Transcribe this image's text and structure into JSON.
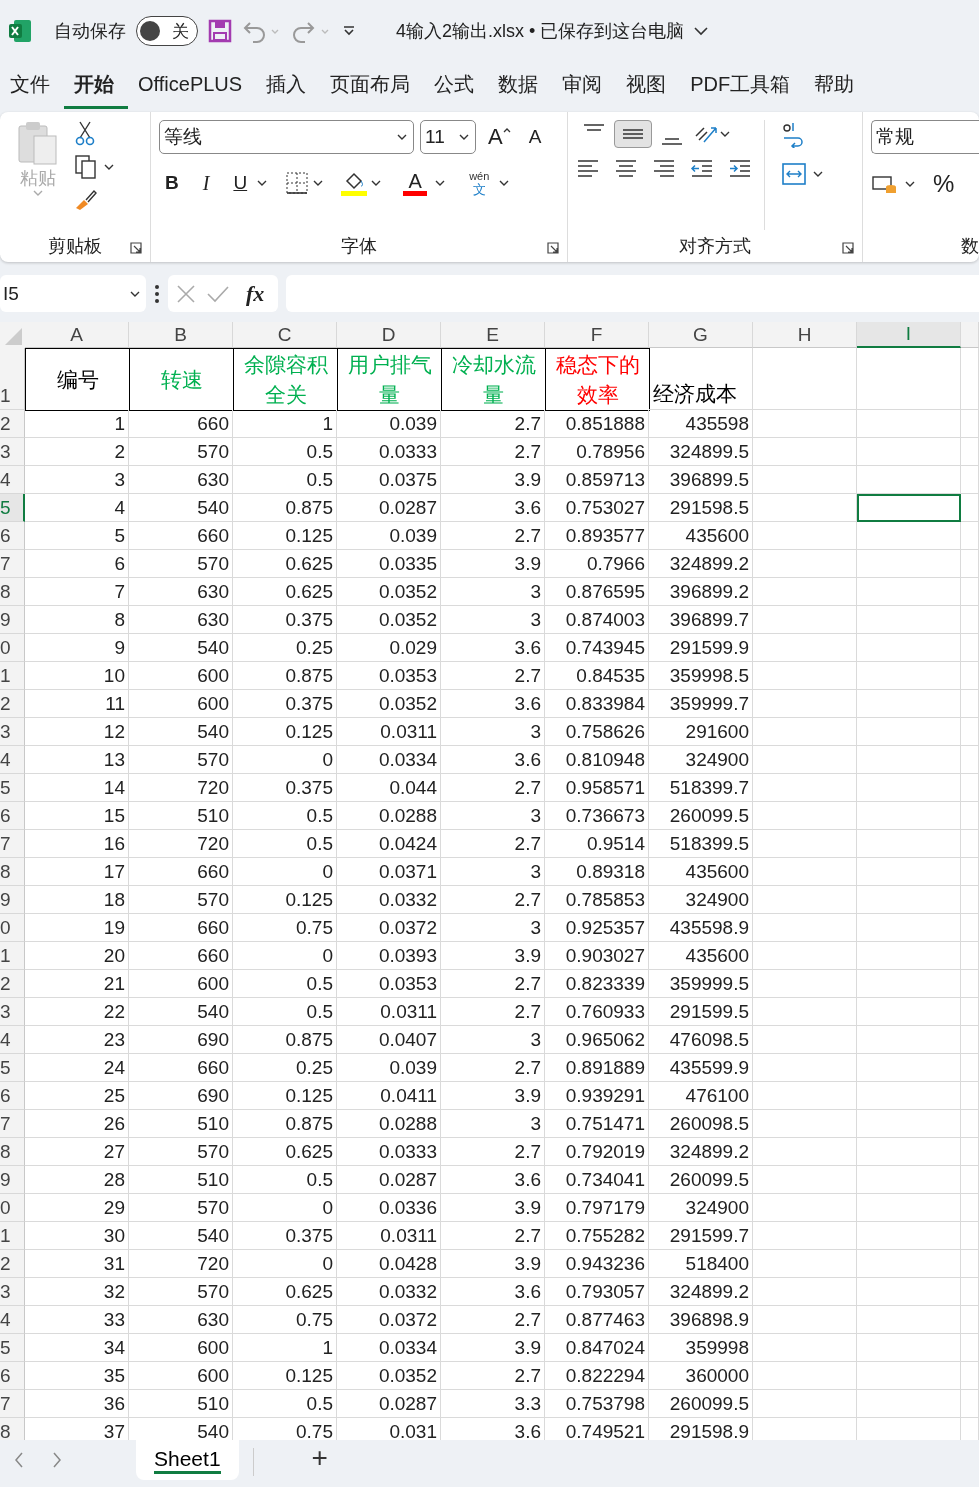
{
  "title_bar": {
    "autosave_label": "自动保存",
    "autosave_on": false,
    "autosave_state": "关",
    "title": "4输入2输出.xlsx • 已保存到这台电脑"
  },
  "tabs": [
    {
      "label": "文件",
      "selected": false
    },
    {
      "label": "开始",
      "selected": true
    },
    {
      "label": "OfficePLUS",
      "selected": false
    },
    {
      "label": "插入",
      "selected": false
    },
    {
      "label": "页面布局",
      "selected": false
    },
    {
      "label": "公式",
      "selected": false
    },
    {
      "label": "数据",
      "selected": false
    },
    {
      "label": "审阅",
      "selected": false
    },
    {
      "label": "视图",
      "selected": false
    },
    {
      "label": "PDF工具箱",
      "selected": false
    },
    {
      "label": "帮助",
      "selected": false
    }
  ],
  "ribbon": {
    "paste_label": "粘贴",
    "clipboard_label": "剪贴板",
    "font_name": "等线",
    "font_size": "11",
    "grow_font": "A",
    "shrink_font": "A",
    "bold": "B",
    "italic": "I",
    "underline": "U",
    "font_color": "A",
    "phonetic": "wén",
    "phonetic_char": "文",
    "font_label": "字体",
    "vertical_align": [
      {
        "selected": false
      },
      {
        "selected": true
      },
      {
        "selected": false
      }
    ],
    "alignment_label": "对齐方式",
    "number_format": "常规",
    "percent": "%",
    "number_label": "数"
  },
  "formula_bar": {
    "name_box": "I5",
    "fx": "fx"
  },
  "columns": [
    {
      "label": "A",
      "selected": false
    },
    {
      "label": "B",
      "selected": false
    },
    {
      "label": "C",
      "selected": false
    },
    {
      "label": "D",
      "selected": false
    },
    {
      "label": "E",
      "selected": false
    },
    {
      "label": "F",
      "selected": false
    },
    {
      "label": "G",
      "selected": false
    },
    {
      "label": "H",
      "selected": false
    },
    {
      "label": "I",
      "selected": true
    }
  ],
  "header_row": {
    "row_label": "1",
    "cells": [
      {
        "text": "编号",
        "color": "#000000",
        "bordered": true
      },
      {
        "text": "转速",
        "color": "#00b050",
        "bordered": true
      },
      {
        "text": "余隙容积全关",
        "color": "#00b050",
        "bordered": true
      },
      {
        "text": "用户排气量",
        "color": "#00b050",
        "bordered": true
      },
      {
        "text": "冷却水流量",
        "color": "#00b050",
        "bordered": true
      },
      {
        "text": "稳态下的效率",
        "color": "#ff0000",
        "bordered": true
      },
      {
        "text": "经济成本",
        "color": "#000000",
        "bordered": false
      }
    ]
  },
  "rows": [
    {
      "row_label": "2",
      "selected": false,
      "cells": [
        "1",
        "660",
        "1",
        "0.039",
        "2.7",
        "0.851888",
        "435598"
      ]
    },
    {
      "row_label": "3",
      "selected": false,
      "cells": [
        "2",
        "570",
        "0.5",
        "0.0333",
        "2.7",
        "0.78956",
        "324899.5"
      ]
    },
    {
      "row_label": "4",
      "selected": false,
      "cells": [
        "3",
        "630",
        "0.5",
        "0.0375",
        "3.9",
        "0.859713",
        "396899.5"
      ]
    },
    {
      "row_label": "5",
      "selected": true,
      "cells": [
        "4",
        "540",
        "0.875",
        "0.0287",
        "3.6",
        "0.753027",
        "291598.5"
      ]
    },
    {
      "row_label": "6",
      "selected": false,
      "cells": [
        "5",
        "660",
        "0.125",
        "0.039",
        "2.7",
        "0.893577",
        "435600"
      ]
    },
    {
      "row_label": "7",
      "selected": false,
      "cells": [
        "6",
        "570",
        "0.625",
        "0.0335",
        "3.9",
        "0.7966",
        "324899.2"
      ]
    },
    {
      "row_label": "8",
      "selected": false,
      "cells": [
        "7",
        "630",
        "0.625",
        "0.0352",
        "3",
        "0.876595",
        "396899.2"
      ]
    },
    {
      "row_label": "9",
      "selected": false,
      "cells": [
        "8",
        "630",
        "0.375",
        "0.0352",
        "3",
        "0.874003",
        "396899.7"
      ]
    },
    {
      "row_label": "0",
      "selected": false,
      "cells": [
        "9",
        "540",
        "0.25",
        "0.029",
        "3.6",
        "0.743945",
        "291599.9"
      ]
    },
    {
      "row_label": "1",
      "selected": false,
      "cells": [
        "10",
        "600",
        "0.875",
        "0.0353",
        "2.7",
        "0.84535",
        "359998.5"
      ]
    },
    {
      "row_label": "2",
      "selected": false,
      "cells": [
        "11",
        "600",
        "0.375",
        "0.0352",
        "3.6",
        "0.833984",
        "359999.7"
      ]
    },
    {
      "row_label": "3",
      "selected": false,
      "cells": [
        "12",
        "540",
        "0.125",
        "0.0311",
        "3",
        "0.758626",
        "291600"
      ]
    },
    {
      "row_label": "4",
      "selected": false,
      "cells": [
        "13",
        "570",
        "0",
        "0.0334",
        "3.6",
        "0.810948",
        "324900"
      ]
    },
    {
      "row_label": "5",
      "selected": false,
      "cells": [
        "14",
        "720",
        "0.375",
        "0.044",
        "2.7",
        "0.958571",
        "518399.7"
      ]
    },
    {
      "row_label": "6",
      "selected": false,
      "cells": [
        "15",
        "510",
        "0.5",
        "0.0288",
        "3",
        "0.736673",
        "260099.5"
      ]
    },
    {
      "row_label": "7",
      "selected": false,
      "cells": [
        "16",
        "720",
        "0.5",
        "0.0424",
        "2.7",
        "0.9514",
        "518399.5"
      ]
    },
    {
      "row_label": "8",
      "selected": false,
      "cells": [
        "17",
        "660",
        "0",
        "0.0371",
        "3",
        "0.89318",
        "435600"
      ]
    },
    {
      "row_label": "9",
      "selected": false,
      "cells": [
        "18",
        "570",
        "0.125",
        "0.0332",
        "2.7",
        "0.785853",
        "324900"
      ]
    },
    {
      "row_label": "0",
      "selected": false,
      "cells": [
        "19",
        "660",
        "0.75",
        "0.0372",
        "3",
        "0.925357",
        "435598.9"
      ]
    },
    {
      "row_label": "1",
      "selected": false,
      "cells": [
        "20",
        "660",
        "0",
        "0.0393",
        "3.9",
        "0.903027",
        "435600"
      ]
    },
    {
      "row_label": "2",
      "selected": false,
      "cells": [
        "21",
        "600",
        "0.5",
        "0.0353",
        "2.7",
        "0.823339",
        "359999.5"
      ]
    },
    {
      "row_label": "3",
      "selected": false,
      "cells": [
        "22",
        "540",
        "0.5",
        "0.0311",
        "2.7",
        "0.760933",
        "291599.5"
      ]
    },
    {
      "row_label": "4",
      "selected": false,
      "cells": [
        "23",
        "690",
        "0.875",
        "0.0407",
        "3",
        "0.965062",
        "476098.5"
      ]
    },
    {
      "row_label": "5",
      "selected": false,
      "cells": [
        "24",
        "660",
        "0.25",
        "0.039",
        "2.7",
        "0.891889",
        "435599.9"
      ]
    },
    {
      "row_label": "6",
      "selected": false,
      "cells": [
        "25",
        "690",
        "0.125",
        "0.0411",
        "3.9",
        "0.939291",
        "476100"
      ]
    },
    {
      "row_label": "7",
      "selected": false,
      "cells": [
        "26",
        "510",
        "0.875",
        "0.0288",
        "3",
        "0.751471",
        "260098.5"
      ]
    },
    {
      "row_label": "8",
      "selected": false,
      "cells": [
        "27",
        "570",
        "0.625",
        "0.0333",
        "2.7",
        "0.792019",
        "324899.2"
      ]
    },
    {
      "row_label": "9",
      "selected": false,
      "cells": [
        "28",
        "510",
        "0.5",
        "0.0287",
        "3.6",
        "0.734041",
        "260099.5"
      ]
    },
    {
      "row_label": "0",
      "selected": false,
      "cells": [
        "29",
        "570",
        "0",
        "0.0336",
        "3.9",
        "0.797179",
        "324900"
      ]
    },
    {
      "row_label": "1",
      "selected": false,
      "cells": [
        "30",
        "540",
        "0.375",
        "0.0311",
        "2.7",
        "0.755282",
        "291599.7"
      ]
    },
    {
      "row_label": "2",
      "selected": false,
      "cells": [
        "31",
        "720",
        "0",
        "0.0428",
        "3.9",
        "0.943236",
        "518400"
      ]
    },
    {
      "row_label": "3",
      "selected": false,
      "cells": [
        "32",
        "570",
        "0.625",
        "0.0332",
        "3.6",
        "0.793057",
        "324899.2"
      ]
    },
    {
      "row_label": "4",
      "selected": false,
      "cells": [
        "33",
        "630",
        "0.75",
        "0.0372",
        "2.7",
        "0.877463",
        "396898.9"
      ]
    },
    {
      "row_label": "5",
      "selected": false,
      "cells": [
        "34",
        "600",
        "1",
        "0.0334",
        "3.9",
        "0.847024",
        "359998"
      ]
    },
    {
      "row_label": "6",
      "selected": false,
      "cells": [
        "35",
        "600",
        "0.125",
        "0.0352",
        "2.7",
        "0.822294",
        "360000"
      ]
    },
    {
      "row_label": "7",
      "selected": false,
      "cells": [
        "36",
        "510",
        "0.5",
        "0.0287",
        "3.3",
        "0.753798",
        "260099.5"
      ]
    },
    {
      "row_label": "8",
      "selected": false,
      "cells": [
        "37",
        "540",
        "0.75",
        "0.031",
        "3.6",
        "0.749521",
        "291598.9"
      ]
    }
  ],
  "sheet_tabs": [
    {
      "label": "Sheet1",
      "selected": true
    }
  ],
  "add_sheet": "+"
}
